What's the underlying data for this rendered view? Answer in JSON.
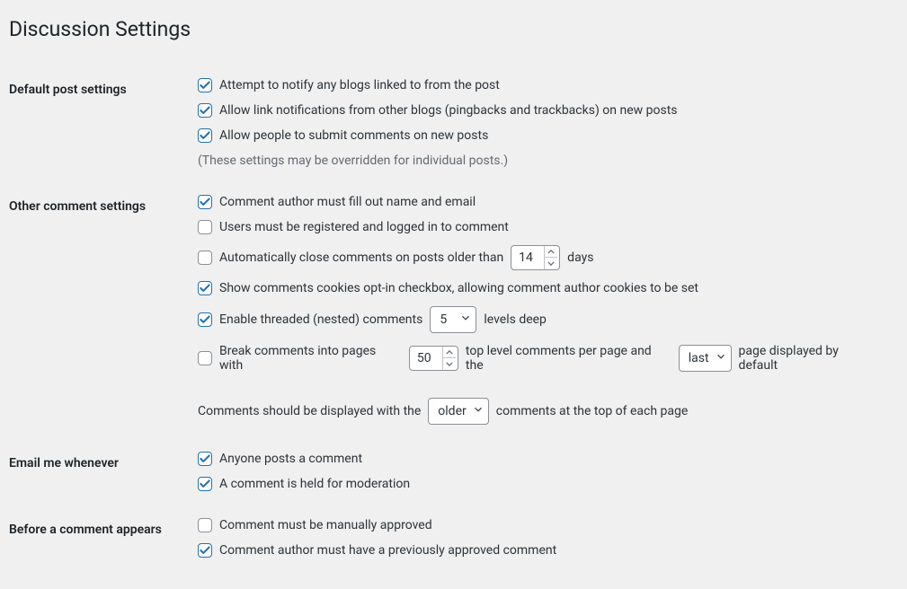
{
  "page_title": "Discussion Settings",
  "sections": {
    "default_post": {
      "heading": "Default post settings",
      "notify_linked": "Attempt to notify any blogs linked to from the post",
      "allow_pingbacks": "Allow link notifications from other blogs (pingbacks and trackbacks) on new posts",
      "allow_comments": "Allow people to submit comments on new posts",
      "note": "(These settings may be overridden for individual posts.)"
    },
    "other_comment": {
      "heading": "Other comment settings",
      "require_name_email": "Comment author must fill out name and email",
      "require_registration": "Users must be registered and logged in to comment",
      "close_comments_prefix": "Automatically close comments on posts older than",
      "close_comments_days": "14",
      "close_comments_suffix": "days",
      "cookies_optin": "Show comments cookies opt-in checkbox, allowing comment author cookies to be set",
      "threaded_prefix": "Enable threaded (nested) comments",
      "threaded_levels": "5",
      "threaded_suffix": "levels deep",
      "pages_prefix": "Break comments into pages with",
      "pages_per": "50",
      "pages_mid": "top level comments per page and the",
      "pages_default": "last",
      "pages_suffix": "page displayed by default",
      "order_prefix": "Comments should be displayed with the",
      "order_value": "older",
      "order_suffix": "comments at the top of each page"
    },
    "email_me": {
      "heading": "Email me whenever",
      "anyone_posts": "Anyone posts a comment",
      "held_moderation": "A comment is held for moderation"
    },
    "before_appears": {
      "heading": "Before a comment appears",
      "manually_approved": "Comment must be manually approved",
      "previously_approved": "Comment author must have a previously approved comment"
    }
  }
}
